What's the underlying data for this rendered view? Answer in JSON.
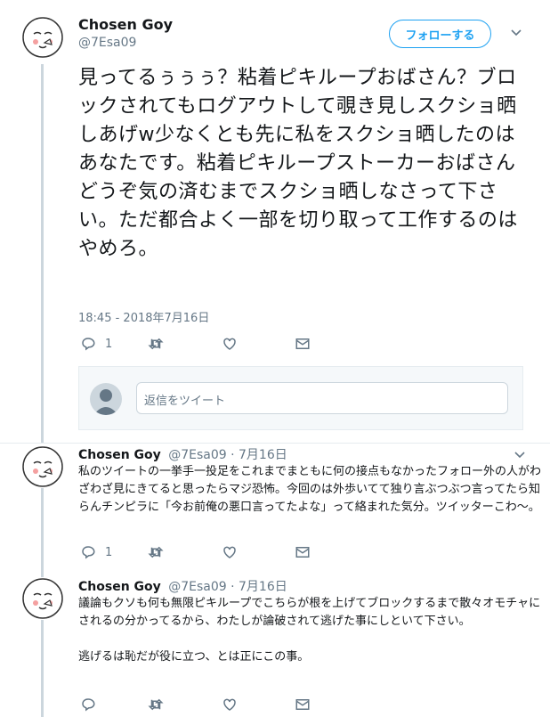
{
  "tweet1": {
    "name": "Chosen Goy",
    "handle": "@7Esa09",
    "follow_label": "フォローする",
    "text": "見ってるぅぅぅ？粘着ピキループおばさん？ブロックされてもログアウトして覗き見しスクショ晒しあげw少なくとも先に私をスクショ晒したのはあなたです。粘着ピキループストーカーおばさんどうぞ気の済むまでスクショ晒しなさって下さい。ただ都合よく一部を切り取って工作するのはやめろ。",
    "timestamp": "18:45 - 2018年7月16日",
    "reply_count": "1"
  },
  "reply_box": {
    "placeholder": "返信をツイート"
  },
  "tweet2": {
    "name": "Chosen Goy",
    "handle_date": "@7Esa09 · 7月16日",
    "text": "私のツイートの一挙手一投足をこれまでまともに何の接点もなかったフォロー外の人がわざわざ見にきてると思ったらマジ恐怖。今回のは外歩いてて独り言ぶつぶつ言ってたら知らんチンピラに「今お前俺の悪口言ってたよな」って絡まれた気分。ツイッターこわ〜。",
    "reply_count": "1"
  },
  "tweet3": {
    "name": "Chosen Goy",
    "handle_date": "@7Esa09 · 7月16日",
    "text": "議論もクソも何も無限ピキループでこちらが根を上げてブロックするまで散々オモチャにされるの分かってるから、わたしが論破されて逃げた事にしといて下さい。\n\n逃げるは恥だが役に立つ、とは正にこの事。"
  }
}
